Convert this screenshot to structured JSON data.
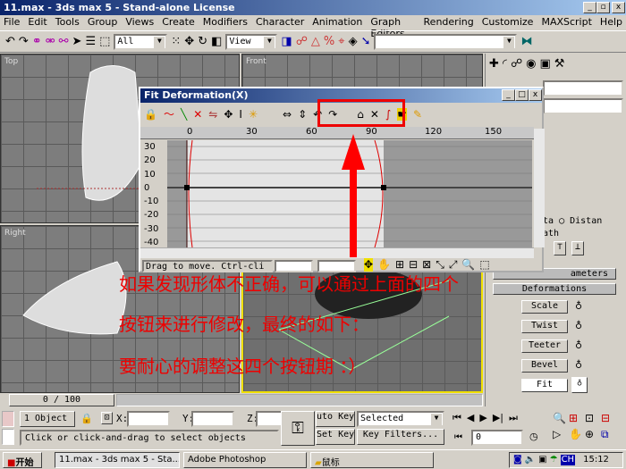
{
  "window": {
    "title": "11.max - 3ds max 5 - Stand-alone License",
    "min": "_",
    "max": "▫",
    "close": "x"
  },
  "menu": [
    "File",
    "Edit",
    "Tools",
    "Group",
    "Views",
    "Create",
    "Modifiers",
    "Character",
    "Animation",
    "Graph Editors",
    "Rendering",
    "Customize",
    "MAXScript",
    "Help"
  ],
  "toolbar": {
    "selection_filter": "All",
    "ref_coord": "View",
    "named_selection": ""
  },
  "viewports": {
    "top": "Top",
    "front": "Front",
    "right": "Right"
  },
  "dialog": {
    "title": "Fit Deformation(X)",
    "ruler": [
      "0",
      "30",
      "60",
      "90",
      "120",
      "150"
    ],
    "yaxis": [
      "30",
      "20",
      "10",
      "0",
      "-10",
      "-20",
      "-30",
      "-40"
    ],
    "status": "Drag to move. Ctrl-cli",
    "field1": "",
    "field2": ""
  },
  "annotation": {
    "line1": "如果发现形体不正确，可以通过上面的四个",
    "line2": "按钮来进行修改，最终的如下：",
    "line3": "要耐心的调整这四个按钮期 ：）"
  },
  "panel": {
    "radio_distance": "Distan",
    "radio_partial1": "ta",
    "partial_path": "ath",
    "rollout_params": "ameters",
    "rollout_deform": "Deformations",
    "buttons": [
      "Scale",
      "Twist",
      "Teeter",
      "Bevel",
      "Fit"
    ]
  },
  "time_slider": "0 / 100",
  "status": {
    "objects": "1 Object",
    "x_label": "X:",
    "y_label": "Y:",
    "z_label": "Z:",
    "prompt": "Click or click-and-drag to select objects",
    "auto_key": "uto Key",
    "set_key": "Set Key",
    "key_mode": "Selected",
    "key_filters": "Key Filters...",
    "frame": "0"
  },
  "taskbar": {
    "start": "开始",
    "items": [
      "11.max - 3ds max 5 - Sta...",
      "Adobe Photoshop",
      "鼠标"
    ],
    "lang": "CH",
    "clock": "15:12"
  },
  "colors": {
    "titlebar": "#0a246a",
    "annotation": "#ee0000",
    "highlight_viewport": "#f0e000"
  }
}
